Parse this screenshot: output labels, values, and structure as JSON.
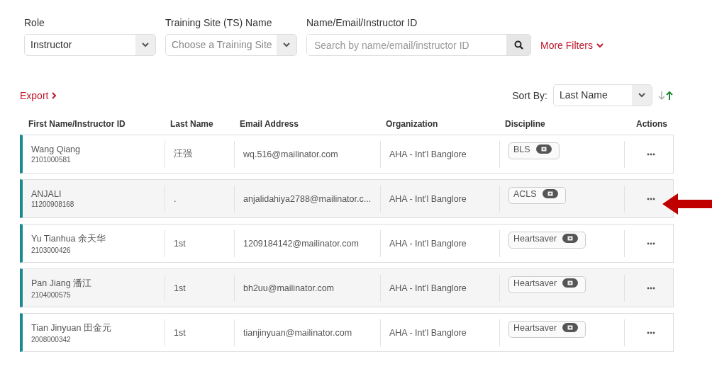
{
  "filters": [
    {
      "kind": "select",
      "label": "Role",
      "value": "Instructor"
    },
    {
      "kind": "select",
      "label": "Training Site (TS) Name",
      "placeholder": "Choose a Training Site"
    },
    {
      "kind": "search",
      "label": "Name/Email/Instructor ID",
      "placeholder": "Search by name/email/instructor ID"
    }
  ],
  "more_filters": "More Filters",
  "export": "Export",
  "sort": {
    "label": "Sort By:",
    "value": "Last Name"
  },
  "table": {
    "columns": [
      "First Name/Instructor ID",
      "Last Name",
      "Email Address",
      "Organization",
      "Discipline",
      "Actions"
    ],
    "rows": [
      {
        "first_name": "Wang Qiang",
        "instructor_id": "2101000581",
        "last_name": "汪强",
        "email": "wq.516@mailinator.com",
        "organization": "AHA - Int'l Banglore",
        "discipline": "BLS"
      },
      {
        "first_name": "ANJALI",
        "instructor_id": "11200908168",
        "last_name": ".",
        "email": "anjalidahiya2788@mailinator.c...",
        "organization": "AHA - Int'l Banglore",
        "discipline": "ACLS"
      },
      {
        "first_name": "Yu Tianhua 余天华",
        "instructor_id": "2103000426",
        "last_name": "1st",
        "email": "1209184142@mailinator.com",
        "organization": "AHA - Int'l Banglore",
        "discipline": "Heartsaver"
      },
      {
        "first_name": "Pan Jiang 潘江",
        "instructor_id": "2104000575",
        "last_name": "1st",
        "email": "bh2uu@mailinator.com",
        "organization": "AHA - Int'l Banglore",
        "discipline": "Heartsaver"
      },
      {
        "first_name": "Tian Jinyuan 田金元",
        "instructor_id": "2008000342",
        "last_name": "1st",
        "email": "tianjinyuan@mailinator.com",
        "organization": "AHA - Int'l Banglore",
        "discipline": "Heartsaver"
      }
    ]
  }
}
